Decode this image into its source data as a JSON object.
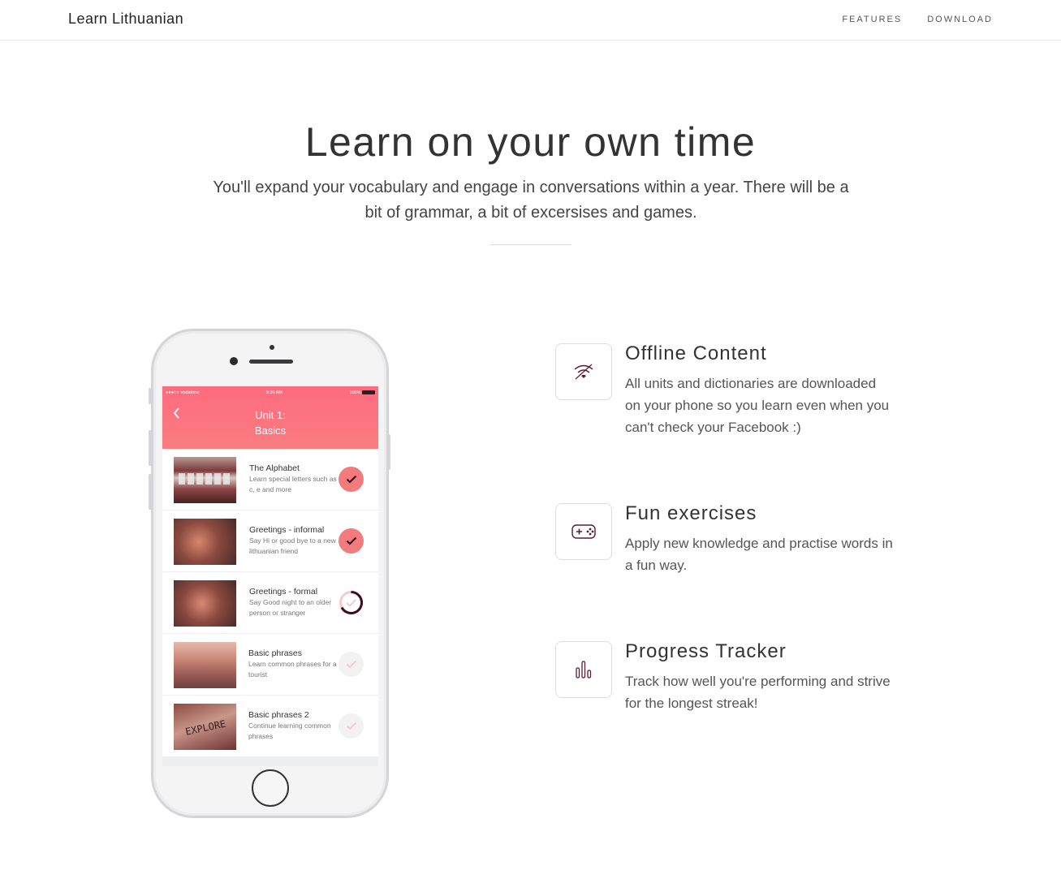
{
  "nav": {
    "brand": "Learn Lithuanian",
    "links": [
      "FEATURES",
      "DOWNLOAD"
    ]
  },
  "hero": {
    "title": "Learn on your own time",
    "subtitle": "You'll expand your vocabulary and engage in conversations within a year. There will be a bit of grammar, a bit of excersises and games."
  },
  "phone": {
    "status": {
      "carrier": "●●●○○ Vodafone",
      "time": "9:30 AM",
      "battery": "100%"
    },
    "unit_line1": "Unit 1:",
    "unit_line2": "Basics",
    "lessons": [
      {
        "title": "The Alphabet",
        "desc": "Learn special letters such as c, e and more",
        "status": "done"
      },
      {
        "title": "Greetings - informal",
        "desc": "Say Hi or good bye to a new lithuanian friend",
        "status": "done"
      },
      {
        "title": "Greetings - formal",
        "desc": "Say Good night to an older person or stranger",
        "status": "in-progress"
      },
      {
        "title": "Basic phrases",
        "desc": "Learn common phrases for a tourist",
        "status": "locked"
      },
      {
        "title": "Basic phrases 2",
        "desc": "Continue learning common phrases",
        "status": "locked"
      }
    ]
  },
  "features": [
    {
      "icon": "offline-wifi-icon",
      "title": "Offline Content",
      "desc": "All units and dictionaries are downloaded on your phone so you learn even when you can't check your Facebook :)"
    },
    {
      "icon": "gamepad-icon",
      "title": "Fun exercises",
      "desc": "Apply new knowledge and practise words in a fun way."
    },
    {
      "icon": "bar-chart-icon",
      "title": "Progress Tracker",
      "desc": "Track how well you're performing and strive for the longest streak!"
    }
  ],
  "colors": {
    "accent": "#fd6b7f",
    "dark_accent": "#5a1a3a",
    "check_done": "#f47b7b",
    "check_locked": "#f2f2f2"
  }
}
